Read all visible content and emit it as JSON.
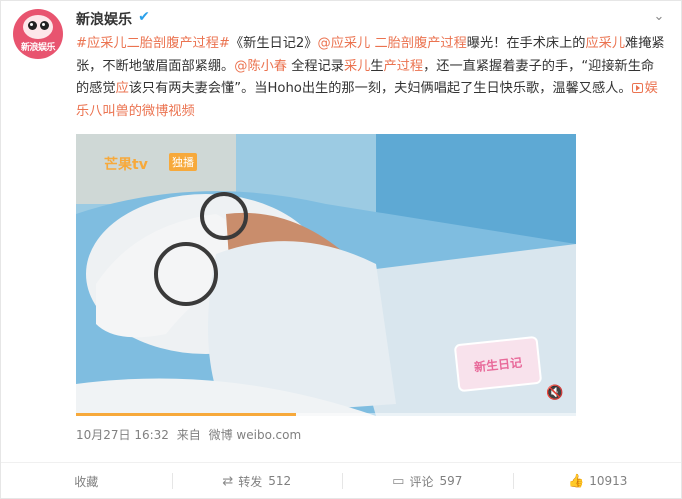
{
  "user": {
    "name": "新浪娱乐",
    "avatar_text": "新浪娱乐",
    "verified": true
  },
  "post": {
    "tag": "#应采儿二胎剖腹产过程#",
    "text_1": "《新生日记2》",
    "mention_1": "@应采儿",
    "tag_2": " 二胎剖腹产过程",
    "text_2": "曝光！在手术床上的",
    "name_hl": "应采儿",
    "text_3": "难掩紧张，不断地皱眉面部紧绷。",
    "mention_2": "@陈小春",
    "text_4": " 全程记录",
    "name_hl_2": "采儿",
    "text_5": "生",
    "word_hl": "产过程",
    "text_6": "，还一直紧握着妻子的手，“迎接新生命的感觉",
    "word_hl_2": "应",
    "text_7": "该只有两夫妻会懂”。当Hoho出生的那一刻，夫妇俩唱起了生日快乐歌，温馨又感人。",
    "video_link": "娱乐八叫兽的微博视频"
  },
  "video": {
    "logo": "芒果tv",
    "badge": "独播",
    "sticker_text": "新生日记",
    "progress": 0.44
  },
  "meta": {
    "time": "10月27日 16:32",
    "source_prefix": "来自",
    "source": "微博 weibo.com"
  },
  "actions": {
    "favorite": "收藏",
    "repost": "转发",
    "repost_count": "512",
    "comment": "评论",
    "comment_count": "597",
    "like_count": "10913"
  },
  "colors": {
    "link": "#eb7350",
    "verify": "#2aa0ea",
    "progress": "#f7a93b"
  }
}
